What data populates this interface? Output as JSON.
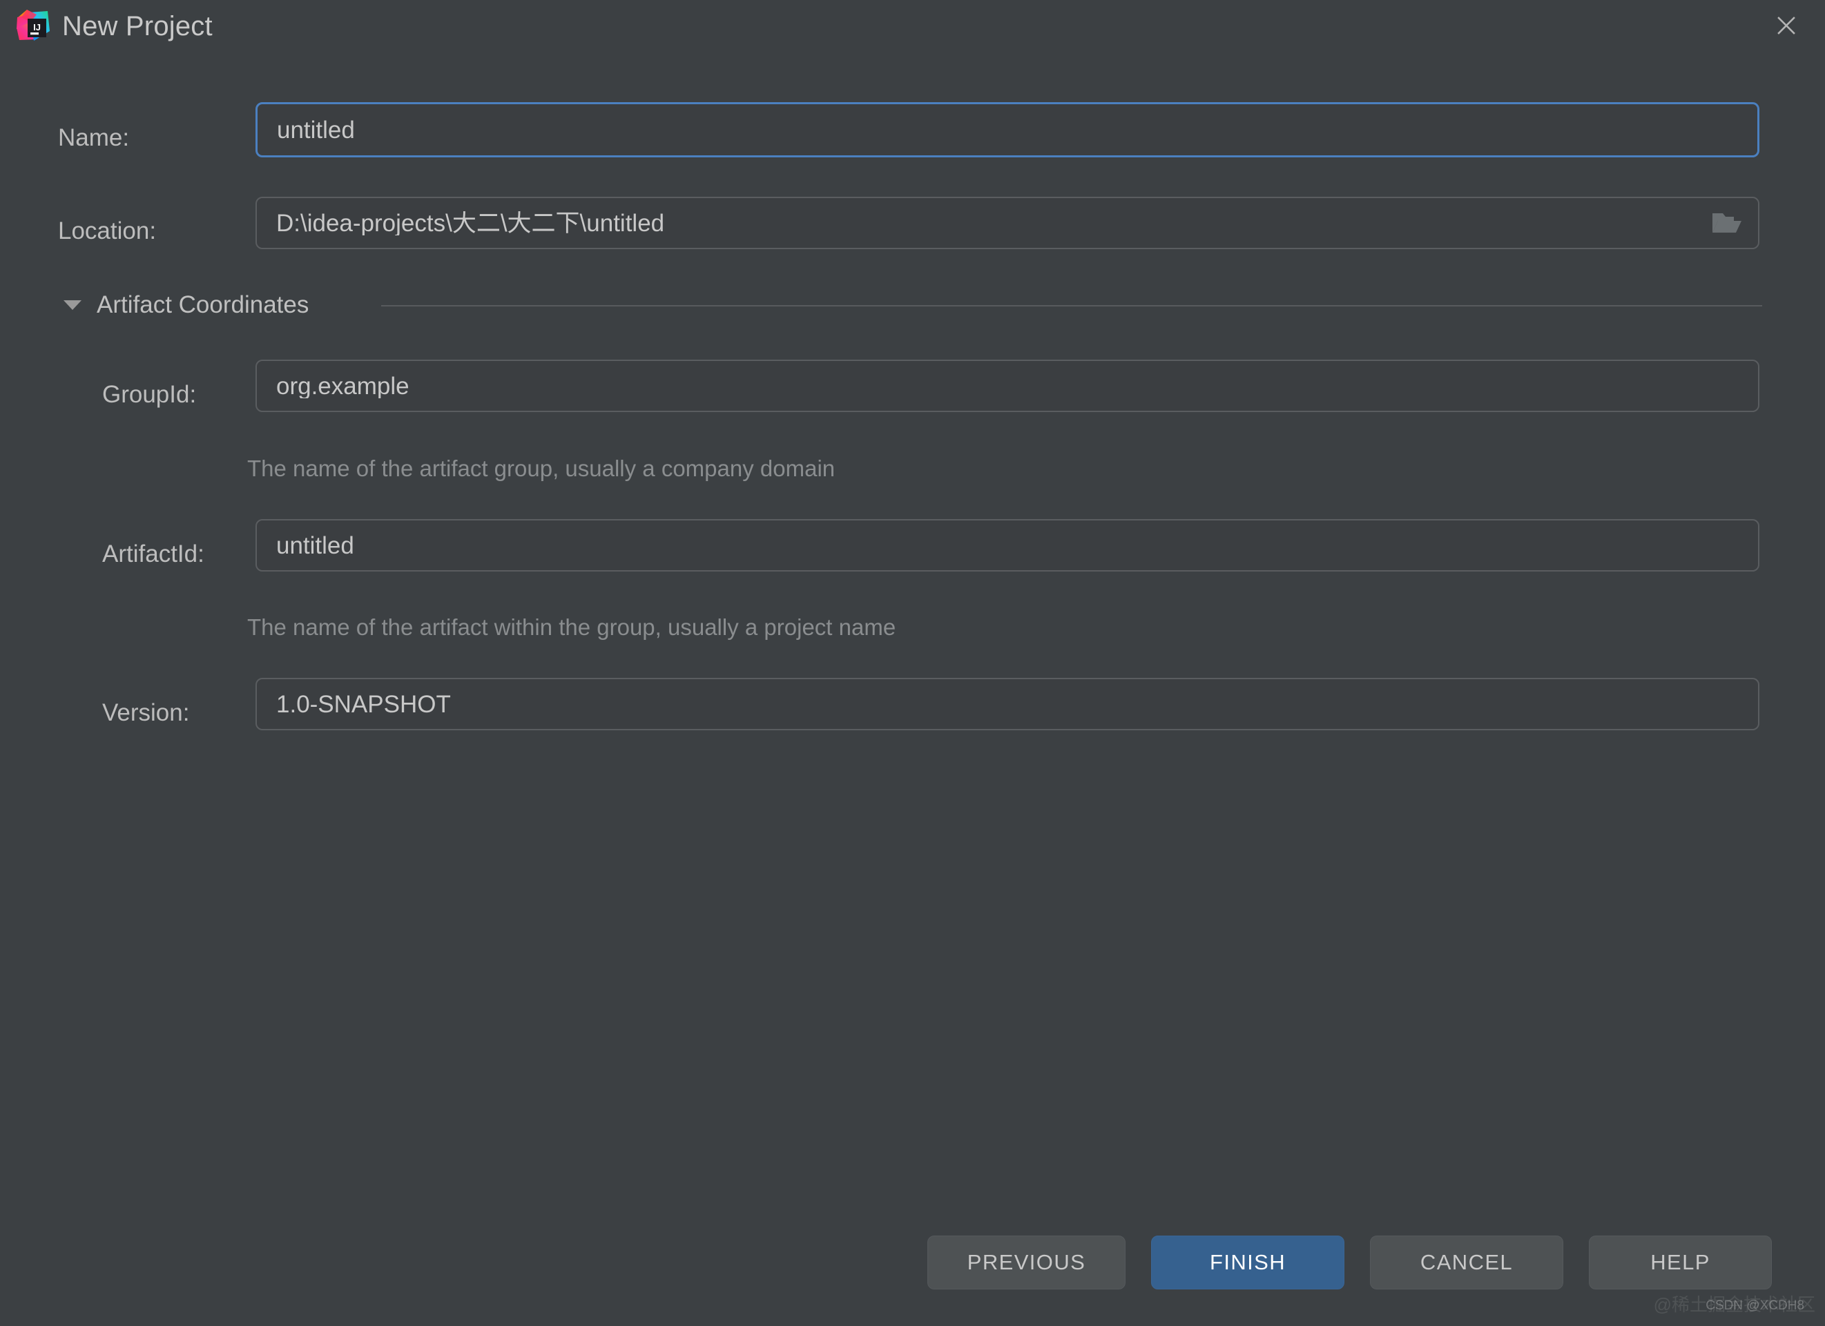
{
  "window": {
    "title": "New Project",
    "app_icon": "intellij-idea-logo-icon",
    "close_icon": "close-icon",
    "background_color": "#3c4043"
  },
  "form": {
    "name": {
      "label": "Name:",
      "value": "untitled",
      "focused": true
    },
    "location": {
      "label": "Location:",
      "value": "D:\\idea-projects\\大二\\大二下\\untitled",
      "browse_icon": "folder-open-icon"
    },
    "artifact_coordinates": {
      "title": "Artifact Coordinates",
      "expanded": true,
      "toggle_icon": "chevron-down-icon",
      "group_id": {
        "label": "GroupId:",
        "value": "org.example",
        "hint": "The name of the artifact group, usually a company domain"
      },
      "artifact_id": {
        "label": "ArtifactId:",
        "value": "untitled",
        "hint": "The name of the artifact within the group, usually a project name"
      },
      "version": {
        "label": "Version:",
        "value": "1.0-SNAPSHOT"
      }
    }
  },
  "footer": {
    "buttons": [
      {
        "label": "PREVIOUS",
        "primary": false
      },
      {
        "label": "FINISH",
        "primary": true
      },
      {
        "label": "CANCEL",
        "primary": false
      },
      {
        "label": "HELP",
        "primary": false
      }
    ],
    "accent_color": "#36618f"
  },
  "watermark": {
    "chinese": "@稀土掘金技术社区",
    "english": "CSDN @XCDH8"
  }
}
